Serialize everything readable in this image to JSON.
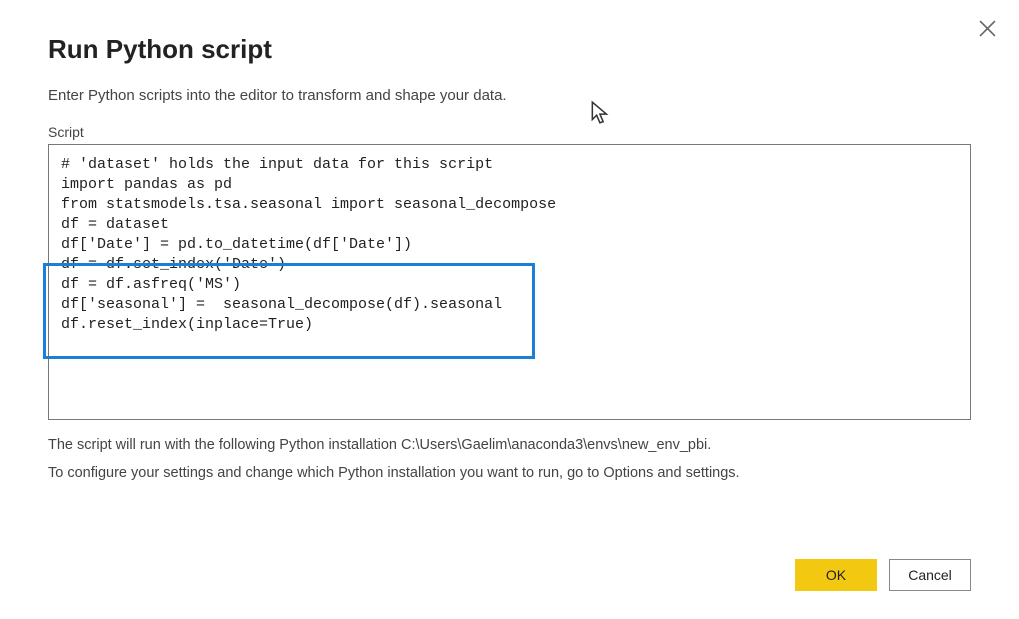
{
  "dialog": {
    "title": "Run Python script",
    "description": "Enter Python scripts into the editor to transform and shape your data.",
    "script_label": "Script",
    "script_content": "# 'dataset' holds the input data for this script\nimport pandas as pd\nfrom statsmodels.tsa.seasonal import seasonal_decompose\ndf = dataset\ndf['Date'] = pd.to_datetime(df['Date'])\ndf = df.set_index('Date')\ndf = df.asfreq('MS')\ndf['seasonal'] =  seasonal_decompose(df).seasonal\ndf.reset_index(inplace=True)",
    "footer_line1": "The script will run with the following Python installation C:\\Users\\Gaelim\\anaconda3\\envs\\new_env_pbi.",
    "footer_line2": "To configure your settings and change which Python installation you want to run, go to Options and settings."
  },
  "buttons": {
    "ok": "OK",
    "cancel": "Cancel"
  }
}
